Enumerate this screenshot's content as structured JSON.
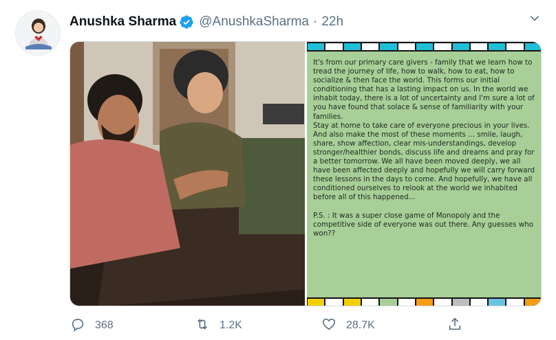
{
  "tweet": {
    "display_name": "Anushka Sharma",
    "handle": "@AnushkaSharma",
    "separator": "·",
    "time": "22h",
    "verified_icon": "verified-badge-icon",
    "caret_icon": "chevron-down-icon",
    "avatar_icon": "avatar",
    "media": {
      "photo_icon": "photo-image",
      "note_text": "It's from our primary care givers - family that we learn how to tread the journey of life, how to walk, how to eat, how to socialize & then face the world. This forms our initial conditioning that has a lasting impact on us. In the world we inhabit today, there is a lot of uncertainty and I'm sure a lot of you have found that solace & sense of familiarity with your families.\nStay at home to take care of everyone precious in your lives. And also make the most of these moments ... smile, laugh, share, show affection, clear mis-understandings, develop stronger/healthier bonds, discuss life and dreams and pray for a better tomorrow. We all have been moved deeply, we all have been affected deeply and hopefully we will carry forward these lessons in the days to come. And hopefully, we have all conditioned ourselves to relook at the world we inhabited before all of this happened...\n\nP.S. : It was a super close game of Monopoly and the competitive side of everyone was out there. Any guesses who won??",
      "panel_color": "#a8cf98",
      "top_strip_colors": [
        "#1ec0d8",
        "#ffffff",
        "#1ec0d8",
        "#ffffff",
        "#1ec0d8",
        "#ffffff",
        "#1ec0d8",
        "#ffffff",
        "#1ec0d8",
        "#ffffff",
        "#1ec0d8",
        "#ffffff",
        "#1ec0d8"
      ],
      "bottom_strip_colors": [
        "#f2d000",
        "#ffffff",
        "#f2d000",
        "#ffffff",
        "#a8cf98",
        "#ffffff",
        "#f59c16",
        "#ffffff",
        "#bdbdbd",
        "#ffffff",
        "#6ac3e0",
        "#ffffff",
        "#f59c16"
      ]
    },
    "actions": {
      "reply": {
        "icon": "reply-icon",
        "count": "368"
      },
      "retweet": {
        "icon": "retweet-icon",
        "count": "1.2K"
      },
      "like": {
        "icon": "like-icon",
        "count": "28.7K"
      },
      "share": {
        "icon": "share-icon",
        "count": ""
      }
    },
    "accent_color": "#1da1f2",
    "secondary_text_color": "#5b7083"
  }
}
